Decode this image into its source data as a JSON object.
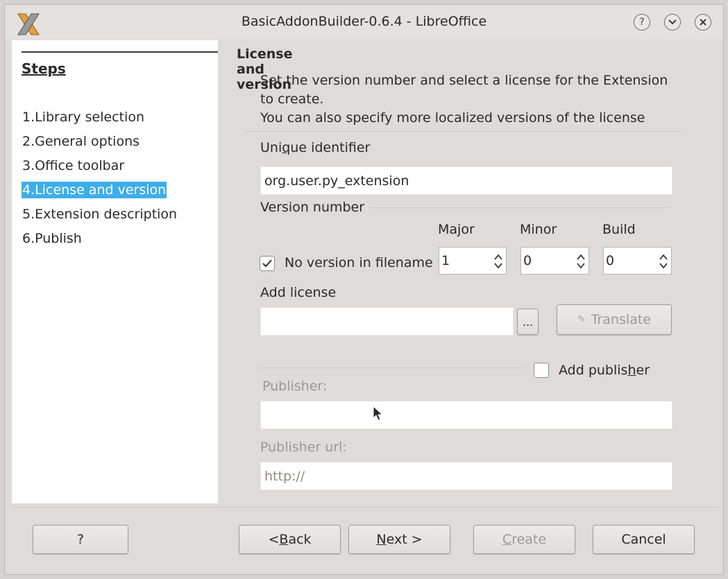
{
  "window": {
    "title": "BasicAddonBuilder-0.6.4 - LibreOffice",
    "controls": {
      "help": "?",
      "minimize": "⌄",
      "close": "✕"
    }
  },
  "steps": {
    "heading": "Steps",
    "items": [
      {
        "label": "1.Library selection",
        "active": false
      },
      {
        "label": "2.General options",
        "active": false
      },
      {
        "label": "3.Office toolbar",
        "active": false
      },
      {
        "label": "4.License and version",
        "active": true
      },
      {
        "label": "5.Extension description",
        "active": false
      },
      {
        "label": "6.Publish",
        "active": false
      }
    ]
  },
  "main": {
    "section_title": "License and version",
    "description_line1": "Set the version number and select a license for the Extension to create.",
    "description_line2": "You can also specify more localized versions of the license",
    "unique_identifier_label_pre": "Uni",
    "unique_identifier_label_u": "q",
    "unique_identifier_label_post": "ue identifier",
    "unique_identifier_value": "org.user.py_extension",
    "version_number_label": "Version number",
    "major_label_pre": "Ma",
    "major_label_u": "j",
    "major_label_post": "or",
    "minor_label": "Minor",
    "build_label": "Build",
    "major_value": "1",
    "minor_value": "0",
    "build_value": "0",
    "no_version_checkbox_label": "No version in filename",
    "no_version_checked": true,
    "add_license_label": "Add license",
    "license_value": "",
    "browse_button": "...",
    "translate_button": "Translate",
    "add_publisher_label_pre": "Add publis",
    "add_publisher_label_u": "h",
    "add_publisher_label_post": "er",
    "add_publisher_checked": false,
    "publisher_label": "Publisher:",
    "publisher_value": "",
    "publisher_url_label": "Publisher url:",
    "publisher_url_placeholder": "http://"
  },
  "footer": {
    "help_button": "?",
    "back_pre": "< ",
    "back_u": "B",
    "back_post": "ack",
    "next_u": "N",
    "next_post": "ext >",
    "create_u": "C",
    "create_post": "reate",
    "cancel_button": "Cancel"
  }
}
